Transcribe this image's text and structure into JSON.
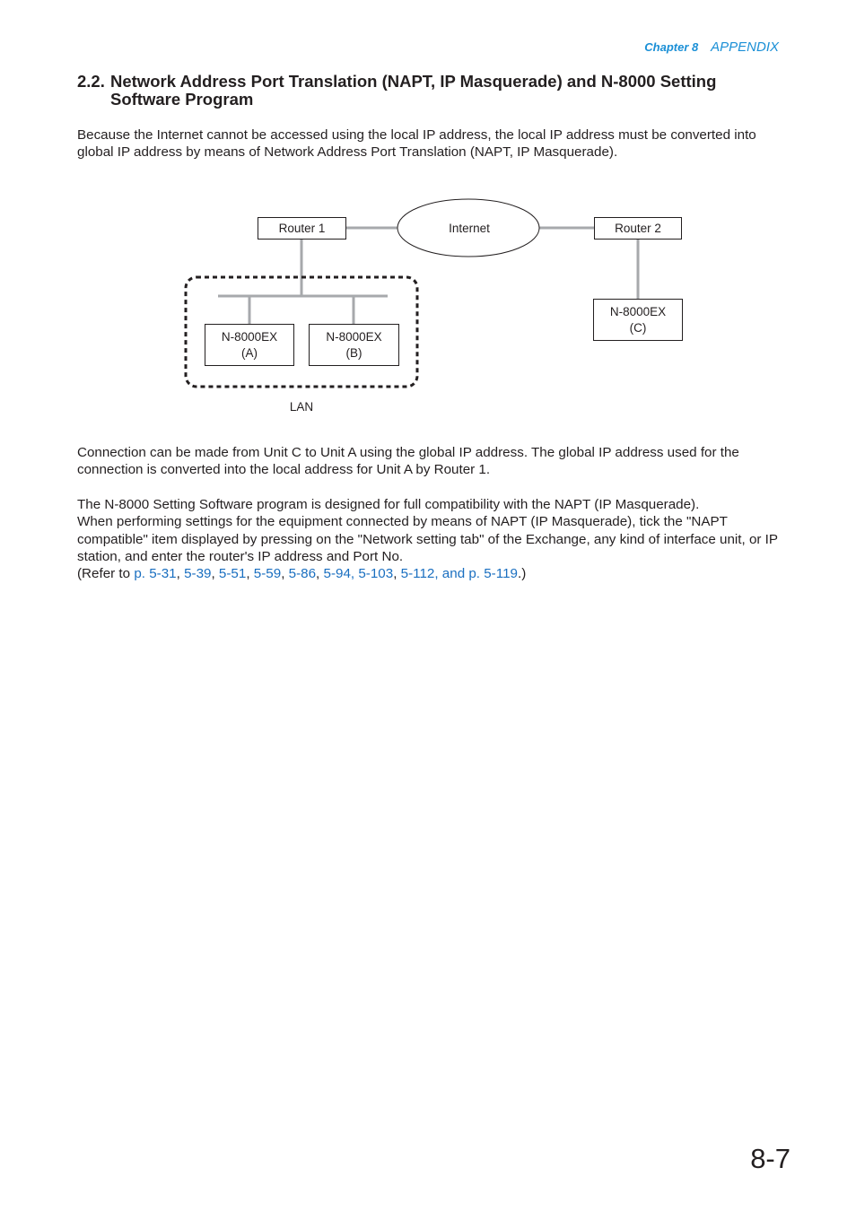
{
  "header": {
    "chapter": "Chapter 8",
    "section": "APPENDIX"
  },
  "title": {
    "number": "2.2.",
    "line1": "Network Address Port Translation (NAPT, IP Masquerade) and N-8000 Setting",
    "line2": "Software Program"
  },
  "paragraphs": {
    "intro": "Because the Internet cannot be accessed using the local IP address, the local IP address must be converted into global IP address by means of Network Address Port Translation (NAPT, IP Masquerade).",
    "connection": "Connection can be made from Unit C to Unit A using the global IP address. The global IP address used for the connection is converted into the local address for Unit A by Router 1.",
    "compat_1": "The N-8000 Setting Software program is designed for full compatibility with the NAPT (IP Masquerade).",
    "compat_2": "When performing settings for the equipment connected by means of NAPT (IP Masquerade), tick the \"NAPT compatible\" item displayed by pressing on the \"Network setting tab\" of the Exchange, any kind of interface unit, or IP station, and enter the router's IP address and Port No.",
    "refer_prefix": "(Refer to ",
    "refer_suffix": ".)",
    "refer_links": [
      "p. 5-31",
      "5-39",
      "5-51",
      "5-59",
      "5-86",
      "5-94, 5-103",
      "5-112, and p. 5-119"
    ],
    "refer_separator": ", "
  },
  "diagram": {
    "router1": "Router 1",
    "router2": "Router 2",
    "internet": "Internet",
    "unit_a_name": "N-8000EX",
    "unit_a_id": "(A)",
    "unit_b_name": "N-8000EX",
    "unit_b_id": "(B)",
    "unit_c_name": "N-8000EX",
    "unit_c_id": "(C)",
    "lan_label": "LAN",
    "line_color": "#a7a9ac",
    "border_color": "#231f20"
  },
  "page_number": "8-7",
  "colors": {
    "accent": "#1a8fd6",
    "link": "#1a6fc0",
    "text": "#231f20"
  }
}
